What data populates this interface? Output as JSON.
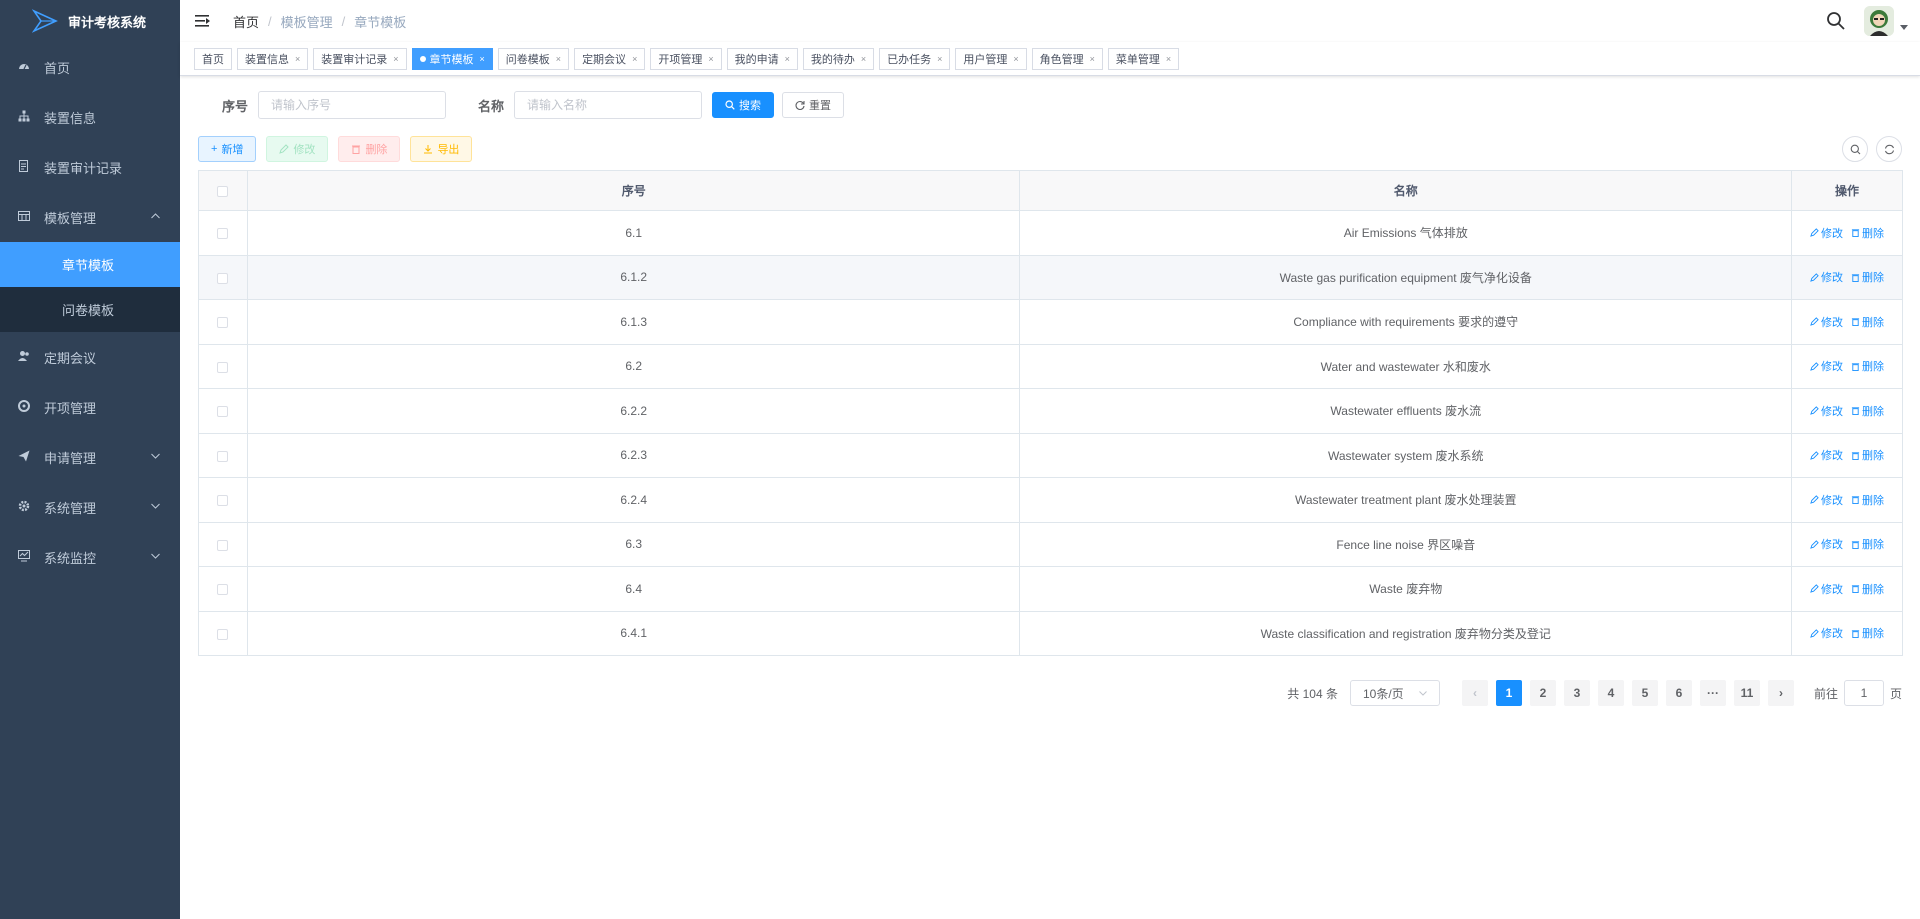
{
  "app": {
    "title": "审计考核系统"
  },
  "sidebar": {
    "items": [
      {
        "label": "首页",
        "icon": "dashboard-icon"
      },
      {
        "label": "装置信息",
        "icon": "tree-icon"
      },
      {
        "label": "装置审计记录",
        "icon": "document-icon"
      },
      {
        "label": "模板管理",
        "icon": "table-icon",
        "expanded": true,
        "children": [
          {
            "label": "章节模板",
            "active": true
          },
          {
            "label": "问卷模板"
          }
        ]
      },
      {
        "label": "定期会议",
        "icon": "peoples-icon"
      },
      {
        "label": "开项管理",
        "icon": "lifebuoy-icon"
      },
      {
        "label": "申请管理",
        "icon": "send-icon",
        "has_arrow": true
      },
      {
        "label": "系统管理",
        "icon": "gear-icon",
        "has_arrow": true
      },
      {
        "label": "系统监控",
        "icon": "monitor-icon",
        "has_arrow": true
      }
    ]
  },
  "breadcrumb": [
    "首页",
    "模板管理",
    "章节模板"
  ],
  "tags": [
    {
      "label": "首页",
      "closable": false
    },
    {
      "label": "装置信息",
      "closable": true
    },
    {
      "label": "装置审计记录",
      "closable": true
    },
    {
      "label": "章节模板",
      "closable": true,
      "active": true
    },
    {
      "label": "问卷模板",
      "closable": true
    },
    {
      "label": "定期会议",
      "closable": true
    },
    {
      "label": "开项管理",
      "closable": true
    },
    {
      "label": "我的申请",
      "closable": true
    },
    {
      "label": "我的待办",
      "closable": true
    },
    {
      "label": "已办任务",
      "closable": true
    },
    {
      "label": "用户管理",
      "closable": true
    },
    {
      "label": "角色管理",
      "closable": true
    },
    {
      "label": "菜单管理",
      "closable": true
    }
  ],
  "search_form": {
    "seq_label": "序号",
    "seq_placeholder": "请输入序号",
    "name_label": "名称",
    "name_placeholder": "请输入名称",
    "search_btn": "搜索",
    "reset_btn": "重置"
  },
  "toolbar": {
    "add": "新增",
    "edit": "修改",
    "delete": "删除",
    "export": "导出"
  },
  "table": {
    "headers": {
      "seq": "序号",
      "name": "名称",
      "ops": "操作"
    },
    "op_edit": "修改",
    "op_delete": "删除",
    "rows": [
      {
        "seq": "6.1",
        "name": "Air Emissions 气体排放"
      },
      {
        "seq": "6.1.2",
        "name": "Waste gas purification equipment 废气净化设备"
      },
      {
        "seq": "6.1.3",
        "name": "Compliance with requirements 要求的遵守"
      },
      {
        "seq": "6.2",
        "name": "Water and wastewater 水和废水"
      },
      {
        "seq": "6.2.2",
        "name": "Wastewater effluents 废水流"
      },
      {
        "seq": "6.2.3",
        "name": "Wastewater system 废水系统"
      },
      {
        "seq": "6.2.4",
        "name": "Wastewater treatment plant 废水处理装置"
      },
      {
        "seq": "6.3",
        "name": "Fence line noise 界区噪音"
      },
      {
        "seq": "6.4",
        "name": "Waste 废弃物"
      },
      {
        "seq": "6.4.1",
        "name": "Waste classification and registration 废弃物分类及登记"
      }
    ]
  },
  "pagination": {
    "total_text": "共 104 条",
    "page_size": "10条/页",
    "pages": [
      "1",
      "2",
      "3",
      "4",
      "5",
      "6",
      "···",
      "11"
    ],
    "current": "1",
    "goto_label": "前往",
    "goto_value": "1",
    "goto_suffix": "页"
  },
  "colors": {
    "sidebar_bg": "#304156",
    "primary": "#1890ff",
    "active_menu": "#409eff"
  }
}
